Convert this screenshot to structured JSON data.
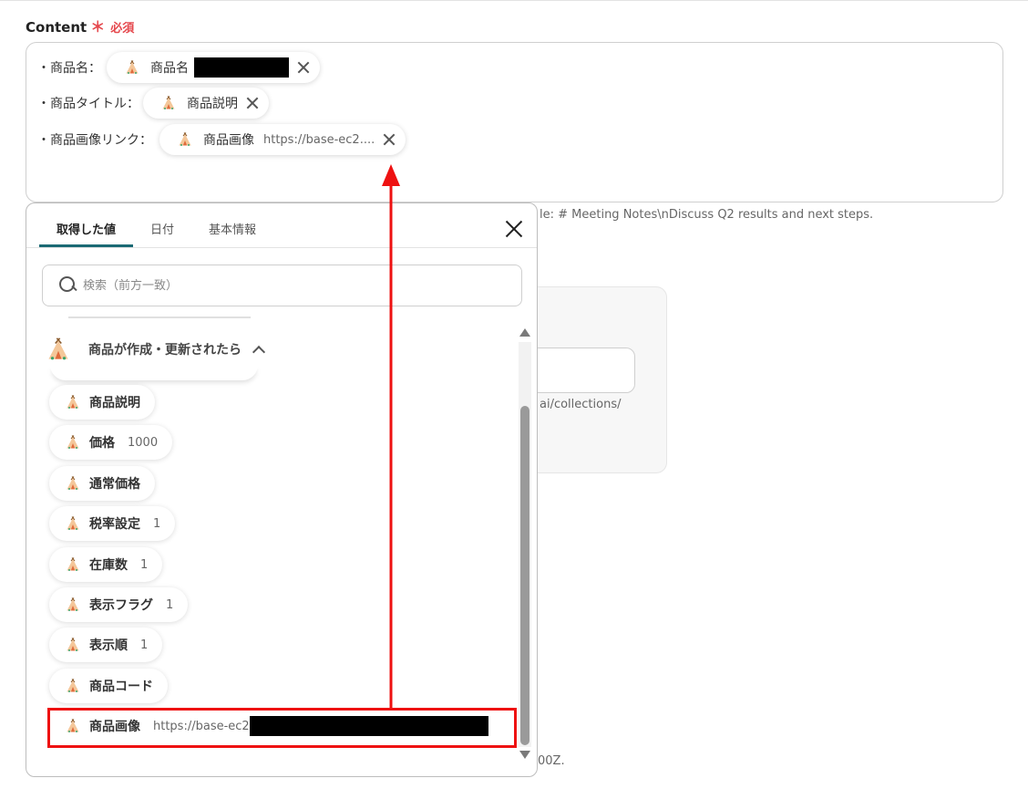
{
  "field": {
    "label": "Content",
    "required_star": "＊",
    "required_text": "必須"
  },
  "content_lines": [
    {
      "label": "・商品名：",
      "pill_name": "商品名"
    },
    {
      "label": "・商品タイトル：",
      "pill_name": "商品説明"
    },
    {
      "label": "・商品画像リンク：",
      "pill_name": "商品画像",
      "pill_value": "https://base-ec2...."
    }
  ],
  "hints": {
    "example": "le: # Meeting Notes\\nDiscuss Q2 results and next steps.",
    "url_tail": "ai/collections/",
    "date_tail": "00Z."
  },
  "popup": {
    "tabs": [
      "取得した値",
      "日付",
      "基本情報"
    ],
    "active_tab": "取得した値",
    "search_placeholder": "検索（前方一致）",
    "group_title": "商品が作成・更新されたら",
    "items": [
      {
        "name": "商品説明",
        "value": ""
      },
      {
        "name": "価格",
        "value": "1000"
      },
      {
        "name": "通常価格",
        "value": ""
      },
      {
        "name": "税率設定",
        "value": "1"
      },
      {
        "name": "在庫数",
        "value": "1"
      },
      {
        "name": "表示フラグ",
        "value": "1"
      },
      {
        "name": "表示順",
        "value": "1"
      },
      {
        "name": "商品コード",
        "value": ""
      },
      {
        "name": "商品画像",
        "value": "https://base-ec2"
      }
    ]
  },
  "colors": {
    "required": "#e5484d",
    "tab_active": "#1b6a74",
    "highlight": "#ee1111",
    "arrow": "#ee1111"
  },
  "icons": {
    "variable": "tipi-icon",
    "close": "close-icon",
    "search": "search-icon",
    "collapse": "chevron-up-icon"
  }
}
